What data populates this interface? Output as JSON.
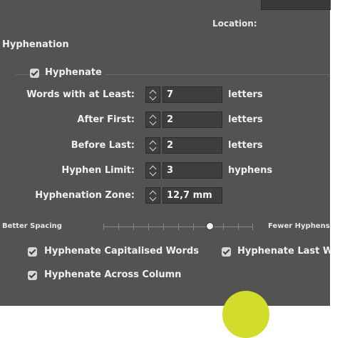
{
  "header": {
    "location_label": "Location:"
  },
  "section_title": "Hyphenation",
  "hyphenate_checkbox": {
    "label": "Hyphenate",
    "checked": true
  },
  "fields": [
    {
      "label": "Words with at Least:",
      "value": "7",
      "unit": "letters"
    },
    {
      "label": "After First:",
      "value": "2",
      "unit": "letters"
    },
    {
      "label": "Before Last:",
      "value": "2",
      "unit": "letters"
    },
    {
      "label": "Hyphen Limit:",
      "value": "3",
      "unit": "hyphens"
    },
    {
      "label": "Hyphenation Zone:",
      "value": "12,7 mm",
      "unit": ""
    }
  ],
  "slider": {
    "left_label": "Better Spacing",
    "right_label": "Fewer Hyphens",
    "value_fraction": 0.71
  },
  "options": [
    {
      "label": "Hyphenate Capitalised Words",
      "checked": true
    },
    {
      "label": "Hyphenate Last Word",
      "checked": true
    },
    {
      "label": "Hyphenate Across Column",
      "checked": true
    }
  ],
  "colors": {
    "panel": "#535353",
    "field": "#3e3e3e",
    "accent_circle": "#d2dc2a"
  }
}
